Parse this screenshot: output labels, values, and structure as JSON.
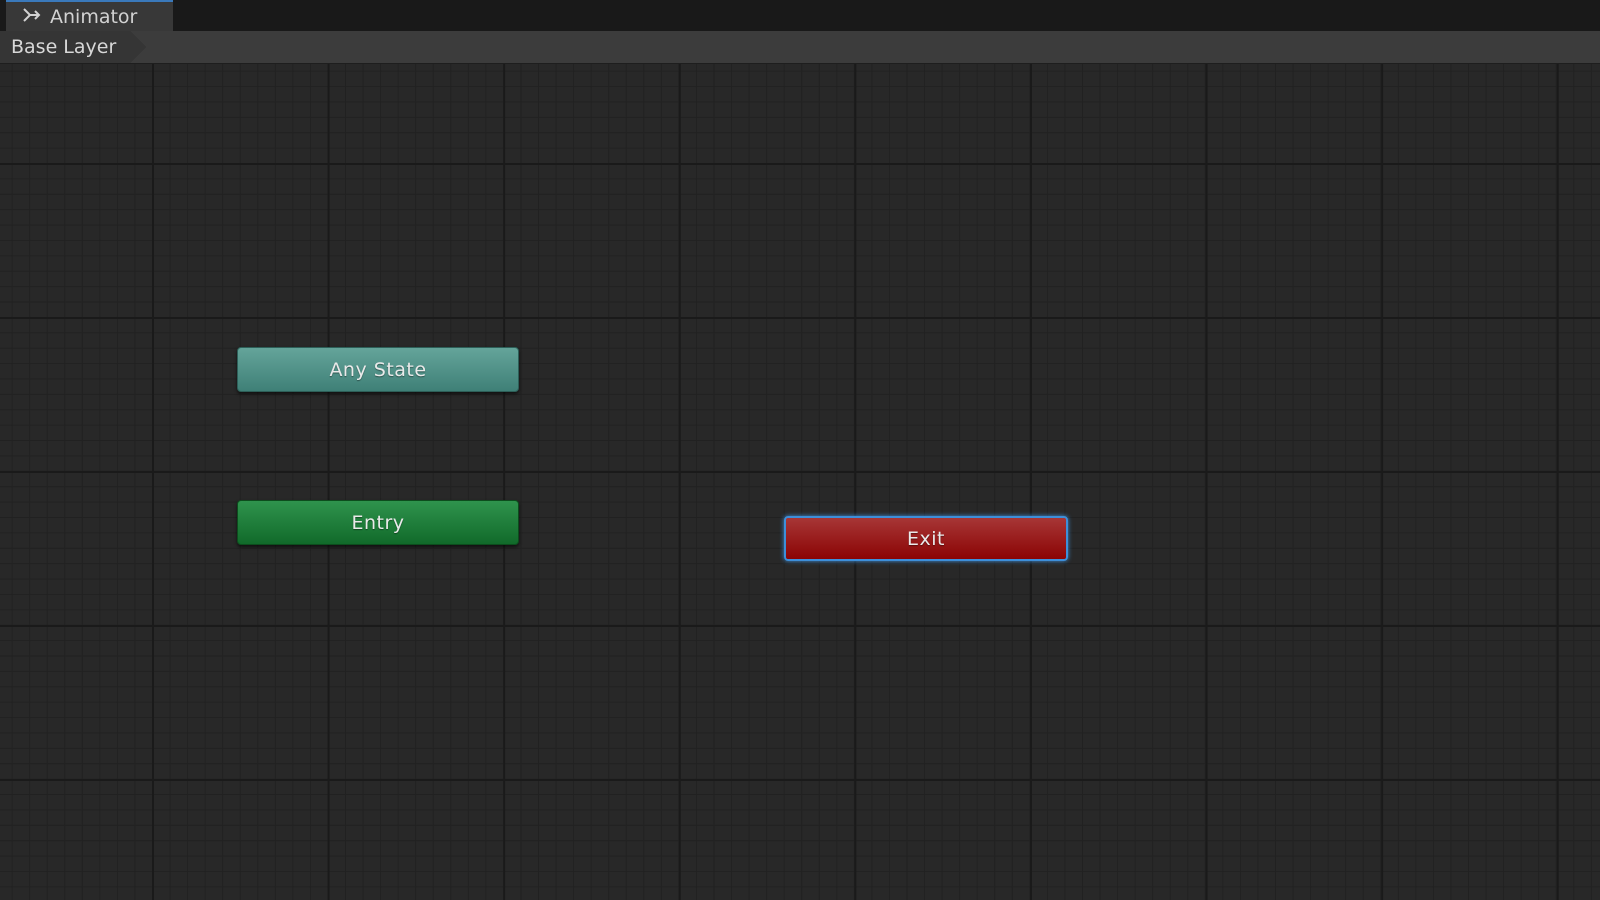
{
  "window": {
    "tab_label": "Animator",
    "tab_icon": "animator-icon"
  },
  "breadcrumb": {
    "items": [
      "Base Layer"
    ]
  },
  "graph": {
    "nodes": {
      "any_state": {
        "label": "Any State",
        "color": "#4f9187"
      },
      "entry": {
        "label": "Entry",
        "color": "#1d7b37"
      },
      "exit": {
        "label": "Exit",
        "color": "#990f0f",
        "selected": true
      }
    }
  },
  "colors": {
    "background": "#282828",
    "selection": "#3d8fd9"
  }
}
